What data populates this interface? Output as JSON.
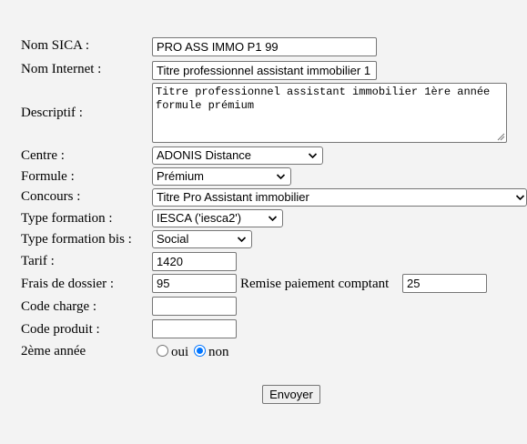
{
  "form": {
    "nom_sica": {
      "label": "Nom SICA :",
      "value": "PRO ASS IMMO P1 99"
    },
    "nom_internet": {
      "label": "Nom Internet :",
      "value": "Titre professionnel assistant immobilier 1"
    },
    "descriptif": {
      "label": "Descriptif :",
      "value": "Titre professionnel assistant immobilier 1ère année formule prémium"
    },
    "centre": {
      "label": "Centre :",
      "selected": "ADONIS Distance"
    },
    "formule": {
      "label": "Formule :",
      "selected": "Prémium"
    },
    "concours": {
      "label": "Concours :",
      "selected": "Titre Pro Assistant immobilier"
    },
    "type_formation": {
      "label": "Type formation :",
      "selected": "IESCA ('iesca2')"
    },
    "type_formation_bis": {
      "label": "Type formation bis :",
      "selected": "Social"
    },
    "tarif": {
      "label": "Tarif :",
      "value": "1420"
    },
    "frais_dossier": {
      "label": "Frais de dossier :",
      "value": "95"
    },
    "remise": {
      "label": "Remise paiement comptant",
      "value": "25"
    },
    "code_charge": {
      "label": "Code charge :",
      "value": ""
    },
    "code_produit": {
      "label": "Code produit :",
      "value": ""
    },
    "deuxieme_annee": {
      "label": "2ème année",
      "option_oui": "oui",
      "option_non": "non",
      "selected": "non"
    },
    "submit_label": "Envoyer"
  }
}
